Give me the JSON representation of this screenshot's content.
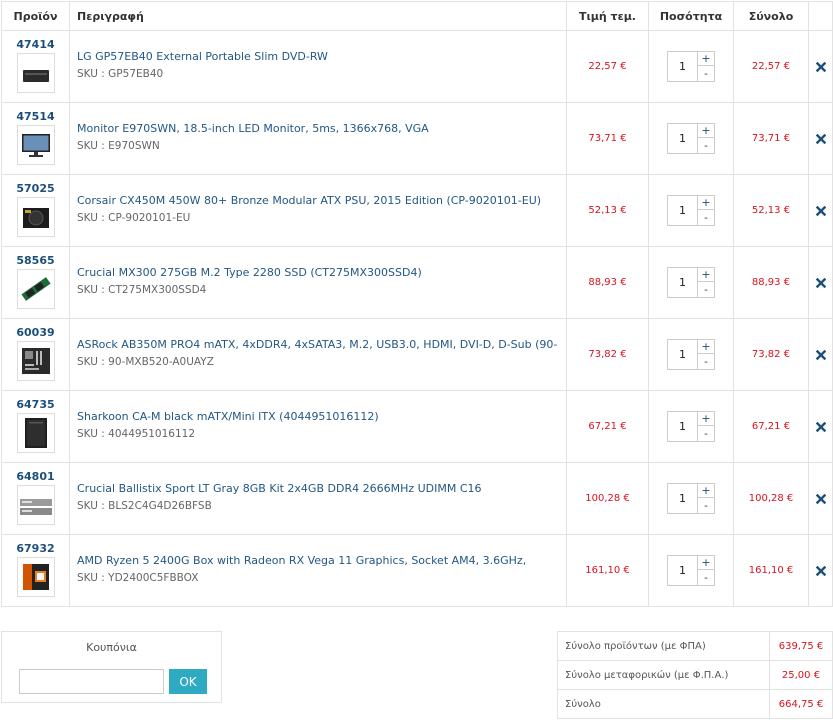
{
  "headers": {
    "product": "Προϊόν",
    "description": "Περιγραφή",
    "unit_price": "Τιμή τεμ.",
    "quantity": "Ποσότητα",
    "total": "Σύνολο"
  },
  "items": [
    {
      "code": "47414",
      "title": "LG GP57EB40 External Portable Slim DVD-RW",
      "sku": "SKU : GP57EB40",
      "price": "22,57 €",
      "qty": "1",
      "total": "22,57 €",
      "thumb": "dvd-drive"
    },
    {
      "code": "47514",
      "title": "Monitor E970SWN, 18.5-inch LED Monitor, 5ms, 1366x768, VGA",
      "sku": "SKU : E970SWN",
      "price": "73,71 €",
      "qty": "1",
      "total": "73,71 €",
      "thumb": "monitor"
    },
    {
      "code": "57025",
      "title": "Corsair CX450M 450W 80+ Bronze Modular ATX PSU, 2015 Edition (CP-9020101-EU)",
      "sku": "SKU : CP-9020101-EU",
      "price": "52,13 €",
      "qty": "1",
      "total": "52,13 €",
      "thumb": "psu"
    },
    {
      "code": "58565",
      "title": "Crucial MX300 275GB M.2 Type 2280 SSD (CT275MX300SSD4)",
      "sku": "SKU : CT275MX300SSD4",
      "price": "88,93 €",
      "qty": "1",
      "total": "88,93 €",
      "thumb": "m2-ssd"
    },
    {
      "code": "60039",
      "title": "ASRock AB350M PRO4 mATX, 4xDDR4, 4xSATA3, M.2, USB3.0, HDMI, DVI-D, D-Sub (90-",
      "sku": "SKU : 90-MXB520-A0UAYZ",
      "price": "73,82 €",
      "qty": "1",
      "total": "73,82 €",
      "thumb": "motherboard"
    },
    {
      "code": "64735",
      "title": "Sharkoon CA-M black mATX/Mini ITX (4044951016112)",
      "sku": "SKU : 4044951016112",
      "price": "67,21 €",
      "qty": "1",
      "total": "67,21 €",
      "thumb": "pc-case"
    },
    {
      "code": "64801",
      "title": "Crucial Ballistix Sport LT Gray 8GB Kit 2x4GB DDR4 2666MHz UDIMM C16",
      "sku": "SKU : BLS2C4G4D26BFSB",
      "price": "100,28 €",
      "qty": "1",
      "total": "100,28 €",
      "thumb": "ram"
    },
    {
      "code": "67932",
      "title": "AMD Ryzen 5 2400G Box with Radeon RX Vega 11 Graphics, Socket AM4, 3.6GHz,",
      "sku": "SKU : YD2400C5FBBOX",
      "price": "161,10 €",
      "qty": "1",
      "total": "161,10 €",
      "thumb": "cpu-box"
    }
  ],
  "qty_buttons": {
    "plus": "+",
    "minus": "-"
  },
  "coupon": {
    "title": "Κουπόνια",
    "input_value": "",
    "button": "OK"
  },
  "totals": [
    {
      "label": "Σύνολο προϊόντων (με ΦΠΑ)",
      "value": "639,75 €"
    },
    {
      "label": "Σύνολο μεταφορικών (με Φ.Π.Α.)",
      "value": "25,00 €"
    },
    {
      "label": "Σύνολο",
      "value": "664,75 €"
    }
  ],
  "colors": {
    "link": "#235784",
    "price": "#d6141f",
    "button": "#2eaac3",
    "border": "#e2e2e2"
  }
}
